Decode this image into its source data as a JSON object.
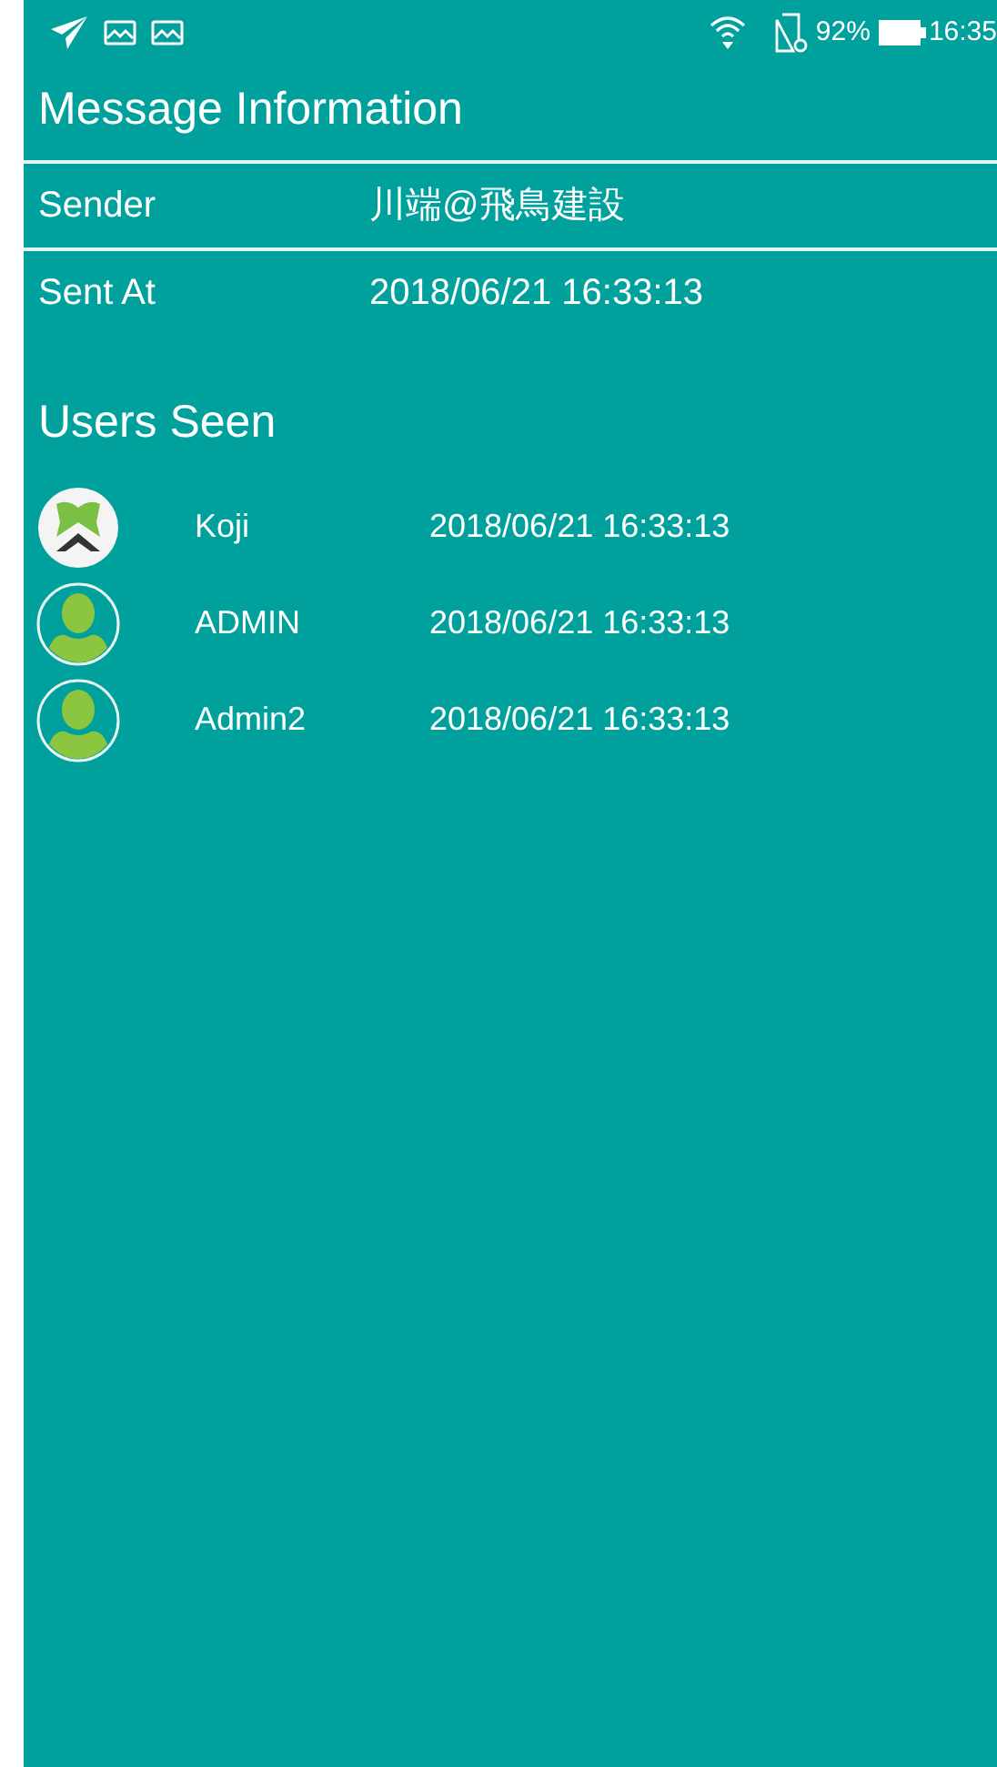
{
  "status_bar": {
    "battery": "92%",
    "time": "16:35"
  },
  "title": "Message Information",
  "fields": [
    {
      "label": "Sender",
      "value": "川端@飛鳥建設"
    },
    {
      "label": "Sent At",
      "value": "2018/06/21 16:33:13"
    }
  ],
  "users_seen": {
    "heading": "Users Seen",
    "users": [
      {
        "name": "Koji",
        "seen_at": "2018/06/21 16:33:13",
        "avatar": {
          "kind": "logo"
        }
      },
      {
        "name": "ADMIN",
        "seen_at": "2018/06/21 16:33:13",
        "avatar": {
          "kind": "person"
        }
      },
      {
        "name": "Admin2",
        "seen_at": "2018/06/21 16:33:13",
        "avatar": {
          "kind": "person"
        }
      }
    ]
  }
}
